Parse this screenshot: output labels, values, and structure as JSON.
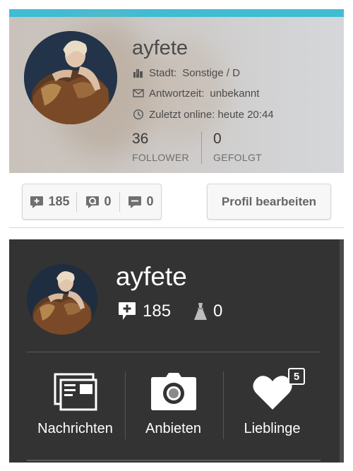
{
  "top_card": {
    "username": "ayfete",
    "city_label": "Stadt:",
    "city_value": "Sonstige / D",
    "response_label": "Antwortzeit:",
    "response_value": "unbekannt",
    "last_online_label": "Zuletzt online:",
    "last_online_value": "heute 20:44",
    "followers_count": "36",
    "followers_label": "FOLLOWER",
    "following_count": "0",
    "following_label": "GEFOLGT",
    "accent_color": "#3fbdd3"
  },
  "counters": {
    "comments": "185",
    "questions": "0",
    "messages": "0"
  },
  "edit_profile_label": "Profil bearbeiten",
  "dark_panel": {
    "username": "ayfete",
    "comments_count": "185",
    "dress_count": "0",
    "nav": [
      {
        "label": "Nachrichten",
        "icon": "messages-icon"
      },
      {
        "label": "Anbieten",
        "icon": "camera-icon"
      },
      {
        "label": "Lieblinge",
        "icon": "heart-icon",
        "badge": "5"
      }
    ]
  }
}
